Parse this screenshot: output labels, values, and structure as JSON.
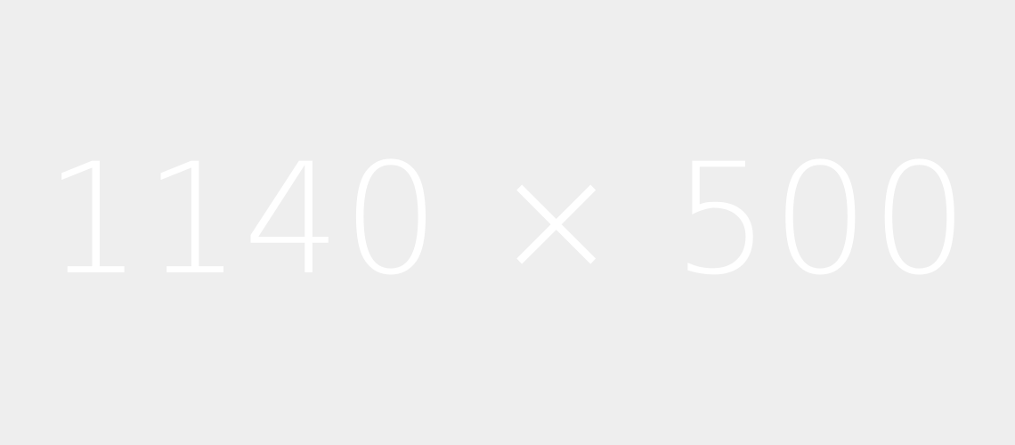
{
  "placeholder": {
    "label": "1140 × 500",
    "background_color": "#eeeeee",
    "text_color": "#ffffff"
  }
}
